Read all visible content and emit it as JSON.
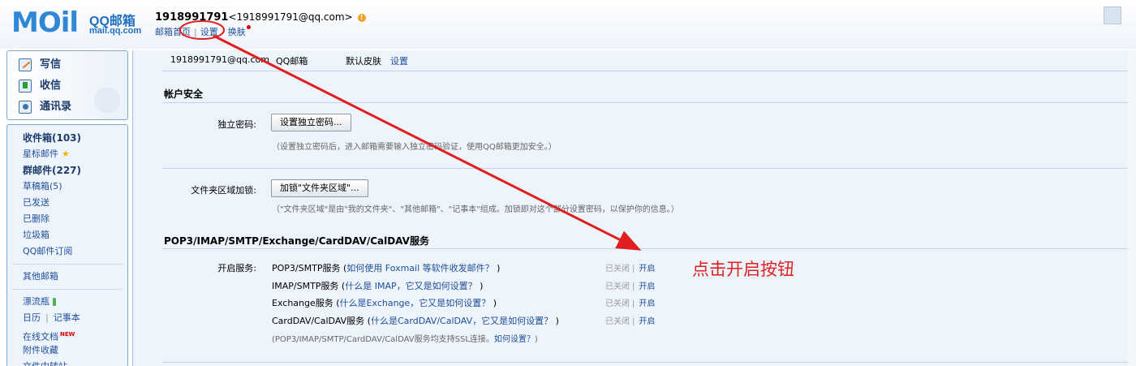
{
  "header": {
    "logo_text": "MOil",
    "logo_qq": "QQ邮箱",
    "logo_domain": "mail.qq.com",
    "account_name": "1918991791",
    "account_email": "<1918991791@qq.com>",
    "warn_icon": "!",
    "nav": [
      "邮箱首页",
      "设置",
      "换肤"
    ]
  },
  "sidebar": {
    "quick": [
      "写信",
      "收信",
      "通讯录"
    ],
    "folders": [
      {
        "label": "收件箱(103)",
        "bold": true
      },
      {
        "label": "星标邮件",
        "bold": false
      },
      {
        "label": "群邮件(227)",
        "bold": true
      },
      {
        "label": "草稿箱(5)",
        "bold": false
      },
      {
        "label": "已发送",
        "bold": false
      },
      {
        "label": "已删除",
        "bold": false
      },
      {
        "label": "垃圾箱",
        "bold": false
      },
      {
        "label": "QQ邮件订阅",
        "bold": false
      }
    ],
    "other_mail": "其他邮箱",
    "apps": {
      "drift_bottle": "漂流瓶",
      "calendar": "日历",
      "notebook": "记事本",
      "online_docs": "在线文档",
      "new_badge": "NEW",
      "attachments": "附件收藏",
      "file_transfer": "文件中转站"
    }
  },
  "main": {
    "info": {
      "email": "1918991791@qq.com",
      "type": "QQ邮箱",
      "skin": "默认皮肤",
      "settings_link": "设置"
    },
    "security": {
      "title": "帐户安全",
      "pwd_label": "独立密码:",
      "pwd_button": "设置独立密码...",
      "pwd_note": "（设置独立密码后，进入邮箱需要输入独立密码验证，使用QQ邮箱更加安全。）",
      "folder_label": "文件夹区域加锁:",
      "folder_button": "加锁\"文件夹区域\"...",
      "folder_note": "（\"文件夹区域\"是由\"我的文件夹\"、\"其他邮箱\"、\"记事本\"组成。加锁即对这个部分设置密码，以保护你的信息。）"
    },
    "services": {
      "title": "POP3/IMAP/SMTP/Exchange/CardDAV/CalDAV服务",
      "enable_label": "开启服务:",
      "rows": [
        {
          "name": "POP3/SMTP服务",
          "link": "如何使用 Foxmail 等软件收发邮件？",
          "status": "已关闭",
          "action": "开启"
        },
        {
          "name": "IMAP/SMTP服务",
          "link": "什么是 IMAP，它又是如何设置？",
          "status": "已关闭",
          "action": "开启"
        },
        {
          "name": "Exchange服务",
          "link": "什么是Exchange，它又是如何设置？",
          "status": "已关闭",
          "action": "开启"
        },
        {
          "name": "CardDAV/CalDAV服务",
          "link": "什么是CardDAV/CalDAV，它又是如何设置？",
          "status": "已关闭",
          "action": "开启"
        }
      ],
      "ssl_note": "(POP3/IMAP/SMTP/CardDAV/CalDAV服务均支持SSL连接。",
      "ssl_link": "如何设置？",
      "ssl_note_end": ")"
    }
  },
  "annotation": {
    "text": "点击开启按钮",
    "color": "#e02020"
  }
}
